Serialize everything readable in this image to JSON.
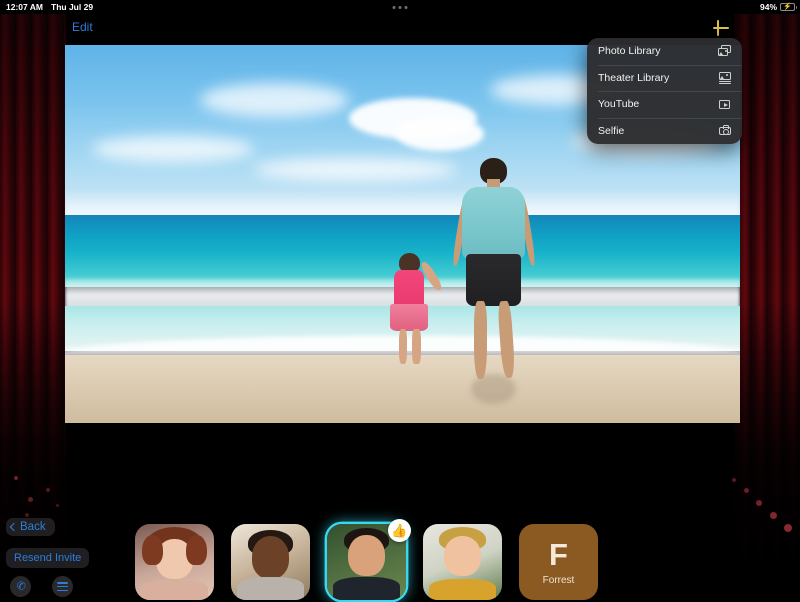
{
  "status_bar": {
    "time": "12:07 AM",
    "date": "Thu Jul 29",
    "battery_percent": "94%",
    "battery_level": 94,
    "charging": true,
    "notch_icon": "three-dots-icon"
  },
  "top_bar": {
    "edit_label": "Edit",
    "add_icon": "plus-icon",
    "add_color": "#e2c64a",
    "edit_color": "#2e7ddb"
  },
  "shared_photo": {
    "description": "Man in teal shirt and black shorts walking on the beach holding hands with a young girl in a pink top and floral skirt, turquoise ocean and blue sky with clouds"
  },
  "menu": {
    "items": [
      {
        "label": "Photo Library",
        "icon": "photo-library-icon"
      },
      {
        "label": "Theater Library",
        "icon": "theater-library-icon"
      },
      {
        "label": "YouTube",
        "icon": "play-button-icon"
      },
      {
        "label": "Selfie",
        "icon": "camera-icon"
      }
    ]
  },
  "controls": {
    "back_label": "Back",
    "back_icon": "chevron-left-icon",
    "resend_label": "Resend Invite",
    "phone_icon": "phone-icon",
    "menu_icon": "hamburger-menu-icon",
    "accent_color": "#2e7ddb"
  },
  "participants": {
    "active_highlight_color": "#38d9f0",
    "tiles": [
      {
        "name": "",
        "type": "video",
        "reaction": ""
      },
      {
        "name": "",
        "type": "video",
        "reaction": ""
      },
      {
        "name": "",
        "type": "video",
        "reaction": "thumbs-up-icon",
        "active": true
      },
      {
        "name": "",
        "type": "video",
        "reaction": ""
      },
      {
        "name": "Forrest",
        "type": "initial",
        "initial": "F",
        "reaction": "",
        "bg_color": "#8a5a22"
      }
    ]
  }
}
